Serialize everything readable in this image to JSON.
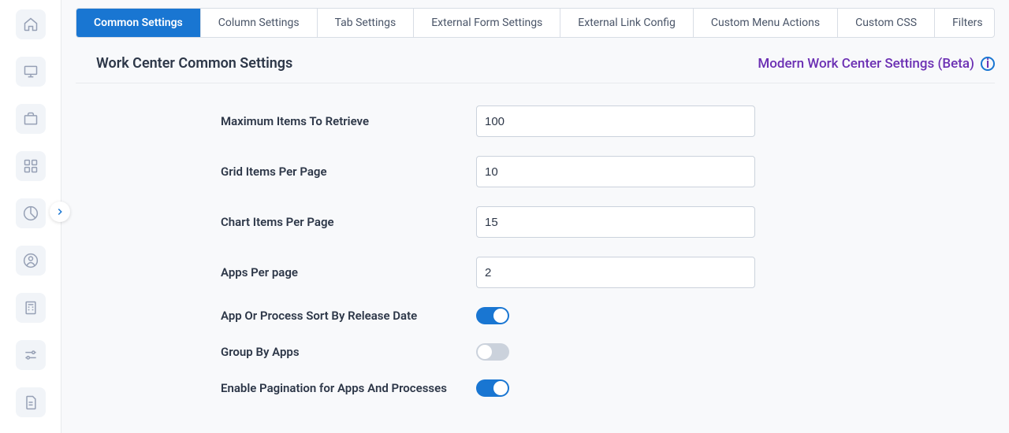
{
  "sidebar": {
    "items": [
      {
        "name": "home"
      },
      {
        "name": "monitor"
      },
      {
        "name": "briefcase"
      },
      {
        "name": "apps"
      },
      {
        "name": "pie-chart"
      },
      {
        "name": "user-circle"
      },
      {
        "name": "calculator"
      },
      {
        "name": "sliders"
      },
      {
        "name": "document"
      }
    ]
  },
  "tabs": [
    {
      "label": "Common Settings",
      "active": true
    },
    {
      "label": "Column Settings"
    },
    {
      "label": "Tab Settings"
    },
    {
      "label": "External Form Settings"
    },
    {
      "label": "External Link Config"
    },
    {
      "label": "Custom Menu Actions"
    },
    {
      "label": "Custom CSS"
    },
    {
      "label": "Filters"
    }
  ],
  "header": {
    "title": "Work Center Common Settings",
    "betaLink": "Modern Work Center Settings (Beta)"
  },
  "form": {
    "maxItems": {
      "label": "Maximum Items To Retrieve",
      "value": "100"
    },
    "gridItems": {
      "label": "Grid Items Per Page",
      "value": "10"
    },
    "chartItems": {
      "label": "Chart Items Per Page",
      "value": "15"
    },
    "appsPerPage": {
      "label": "Apps Per page",
      "value": "2"
    },
    "sortByDate": {
      "label": "App Or Process Sort By Release Date",
      "on": true
    },
    "groupByApps": {
      "label": "Group By Apps",
      "on": false
    },
    "enablePag": {
      "label": "Enable Pagination for Apps And Processes",
      "on": true
    }
  }
}
